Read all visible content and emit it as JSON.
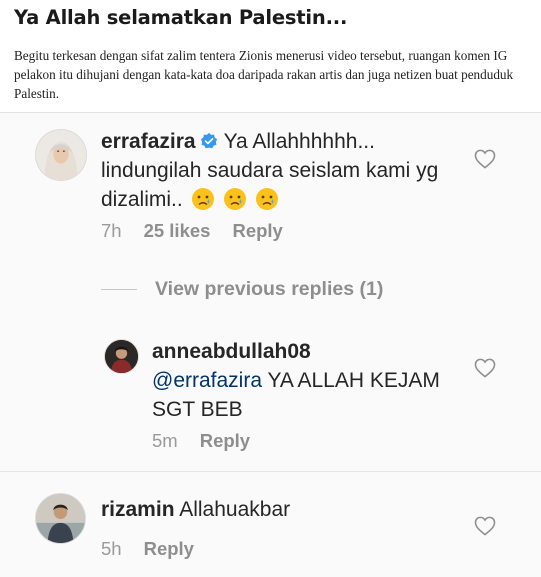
{
  "article": {
    "headline": "Ya Allah selamatkan Palestin...",
    "paragraph": "Begitu terkesan dengan sifat zalim tentera Zionis menerusi video tersebut, ruangan komen IG pelakon itu dihujani dengan kata-kata doa daripada rakan artis  dan juga netizen buat penduduk Palestin."
  },
  "comments": [
    {
      "username": "errafazira",
      "text": "Ya Allahhhhhh... lindungilah saudara seislam kami yg dizalimi..",
      "time": "7h",
      "likes": "25 likes",
      "reply": "Reply",
      "emojis": [
        "crying-face-icon",
        "crying-face-icon",
        "crying-face-icon"
      ]
    },
    {
      "username": "anneabdullah08",
      "mention": "@errafazira",
      "text": "YA ALLAH KEJAM SGT BEB",
      "time": "5m",
      "reply": "Reply"
    },
    {
      "username": "rizamin",
      "text": "Allahuakbar",
      "time": "5h",
      "reply": "Reply"
    }
  ],
  "view_previous": "View previous replies (1)",
  "colors": {
    "username": "#262626",
    "meta": "#8e8e8e",
    "mention": "#003569",
    "verified": "#3897f0",
    "background": "#fafafa"
  }
}
